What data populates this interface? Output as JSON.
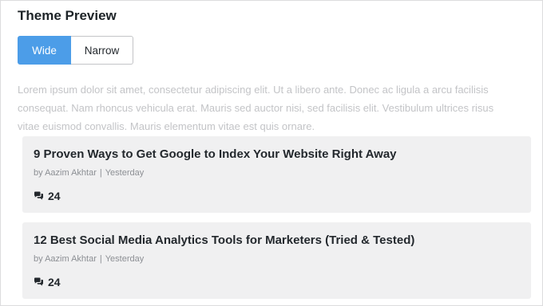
{
  "page": {
    "title": "Theme Preview"
  },
  "layout_toggle": {
    "options": [
      {
        "label": "Wide",
        "active": true
      },
      {
        "label": "Narrow",
        "active": false
      }
    ],
    "selected": "Wide"
  },
  "intro": {
    "text": "Lorem ipsum dolor sit amet, consectetur adipiscing elit. Ut a libero ante. Donec ac ligula a arcu facilisis consequat. Nam rhoncus vehicula erat. Mauris sed auctor nisi, sed facilisis elit. Vestibulum ultrices risus vitae euismod convallis. Mauris elementum vitae est quis ornare."
  },
  "posts": [
    {
      "title": "9 Proven Ways to Get Google to Index Your Website Right Away",
      "author": "by Aazim Akhtar",
      "separator": "|",
      "date": "Yesterday",
      "comments": "24",
      "comment_icon": "comments-icon"
    },
    {
      "title": "12 Best Social Media Analytics Tools for Marketers (Tried & Tested)",
      "author": "by Aazim Akhtar",
      "separator": "|",
      "date": "Yesterday",
      "comments": "24",
      "comment_icon": "comments-icon"
    }
  ],
  "colors": {
    "accent": "#4c9de8",
    "card_background": "#f0f0f1",
    "muted_text": "#c3c4c7",
    "meta_text": "#8c8f94"
  }
}
